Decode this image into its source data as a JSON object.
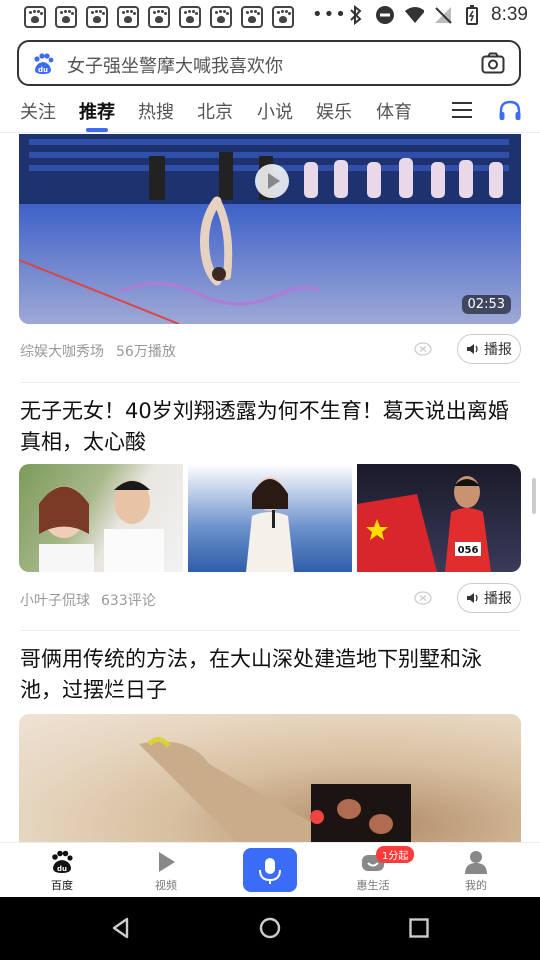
{
  "status_bar": {
    "app_notification_count": 9,
    "time": "8:39"
  },
  "search": {
    "placeholder": "女子强坐警摩大喊我喜欢你"
  },
  "tabs": [
    {
      "label": "关注"
    },
    {
      "label": "推荐"
    },
    {
      "label": "热搜"
    },
    {
      "label": "北京"
    },
    {
      "label": "小说"
    },
    {
      "label": "娱乐"
    },
    {
      "label": "体育"
    }
  ],
  "feed": {
    "cards": [
      {
        "type": "video",
        "duration": "02:53",
        "source": "综娱大咖秀场",
        "stat": "56万播放",
        "broadcast_label": "播报"
      },
      {
        "type": "three-image",
        "title": "无子无女！40岁刘翔透露为何不生育！葛天说出离婚真相，太心酸",
        "source": "小叶子侃球",
        "stat": "633评论",
        "broadcast_label": "播报"
      },
      {
        "type": "large-image",
        "title": "哥俩用传统的方法，在大山深处建造地下别墅和泳池，过摆烂日子"
      }
    ]
  },
  "bottom_nav": {
    "items": [
      {
        "label": "百度",
        "icon": "baidu-paw-icon"
      },
      {
        "label": "视频",
        "icon": "video-play-icon"
      },
      {
        "label": "",
        "icon": "microphone-icon"
      },
      {
        "label": "惠生活",
        "icon": "life-icon",
        "badge": "1分起"
      },
      {
        "label": "我的",
        "icon": "profile-icon"
      }
    ]
  }
}
